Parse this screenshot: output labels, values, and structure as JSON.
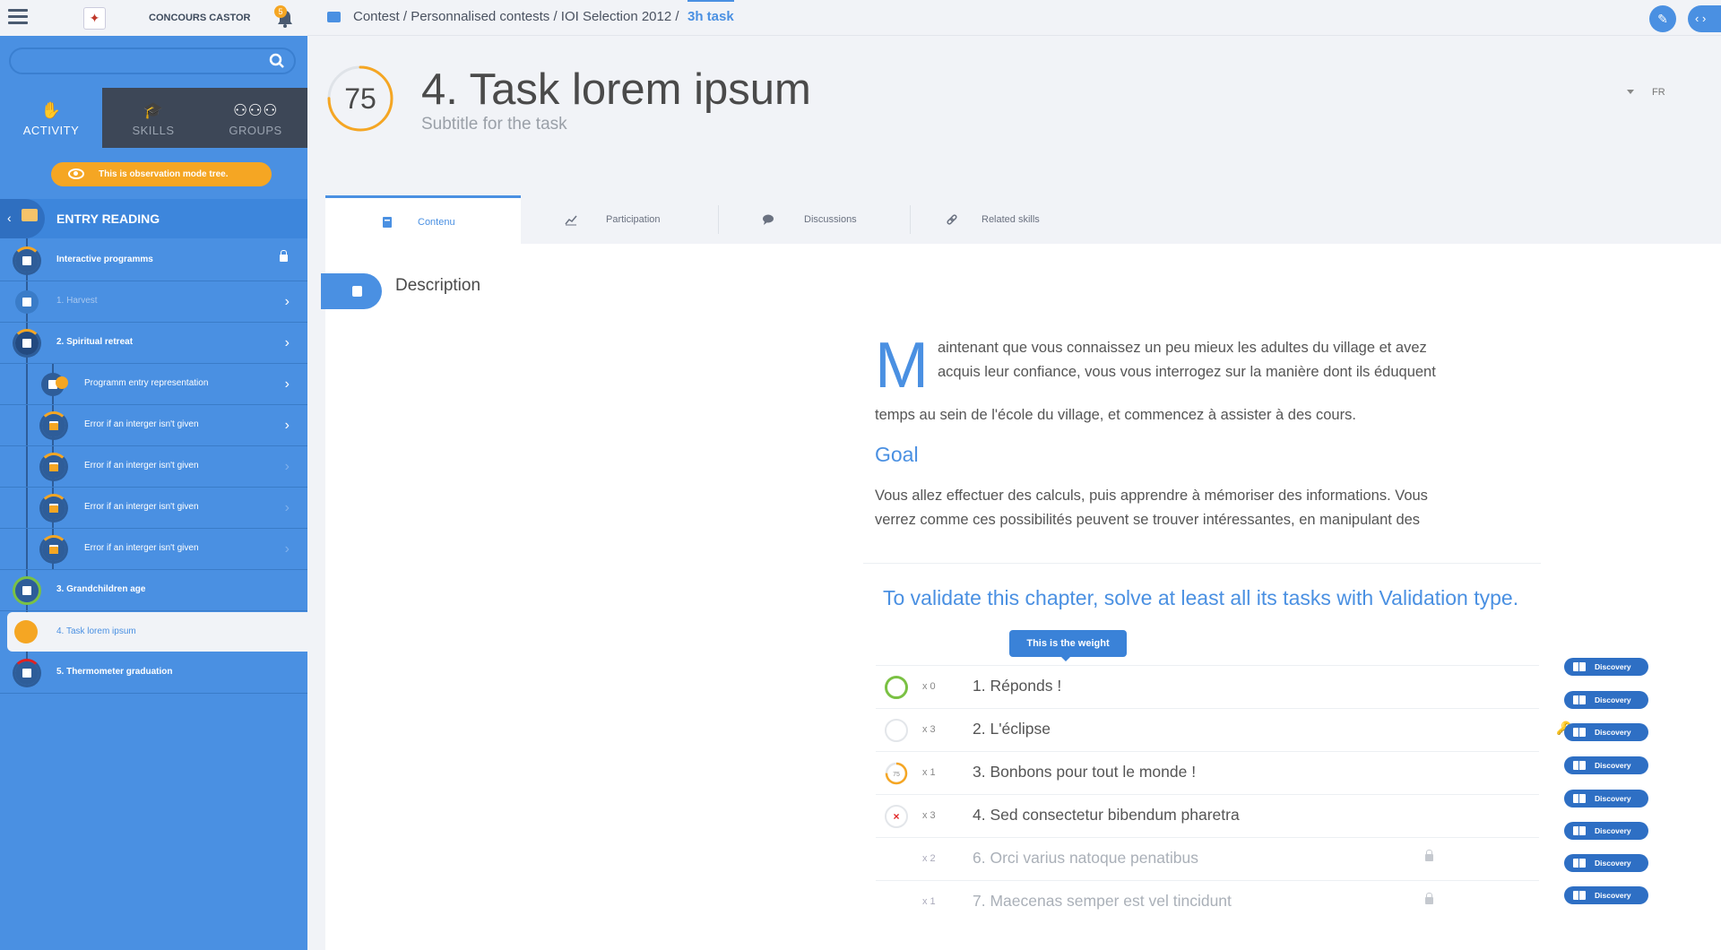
{
  "app": {
    "brand": "CONCOURS CASTOR",
    "notification_count": "5"
  },
  "sidebar": {
    "tabs": [
      {
        "label": "ACTIVITY",
        "icon": "hand-icon",
        "active": true
      },
      {
        "label": "SKILLS",
        "icon": "graduation-cap-icon",
        "active": false
      },
      {
        "label": "GROUPS",
        "icon": "groups-icon",
        "active": false
      }
    ],
    "observation_banner": "This is observation mode tree.",
    "section_title": "ENTRY READING",
    "items": [
      {
        "label": "Interactive programms",
        "locked": true
      },
      {
        "label": "1. Harvest"
      },
      {
        "label": "2. Spiritual retreat"
      },
      {
        "label": "Programm entry representation"
      },
      {
        "label": "Error if an interger isn't given"
      },
      {
        "label": "Error if an interger isn't given"
      },
      {
        "label": "Error if an interger isn't given"
      },
      {
        "label": "Error if an interger isn't given"
      },
      {
        "label": "3. Grandchildren age"
      },
      {
        "label": "4. Task lorem ipsum",
        "active": true
      },
      {
        "label": "5. Thermometer graduation"
      }
    ]
  },
  "breadcrumb": {
    "path": "Contest / Personnalised contests / IOI Selection 2012 /",
    "current": "3h task"
  },
  "task": {
    "score": "75",
    "score_fraction": 0.75,
    "title": "4. Task lorem ipsum",
    "subtitle": "Subtitle for the task",
    "language": "FR"
  },
  "tabs": [
    {
      "label": "Contenu",
      "icon": "book-icon",
      "active": true
    },
    {
      "label": "Participation",
      "icon": "chart-icon"
    },
    {
      "label": "Discussions",
      "icon": "chat-icon"
    },
    {
      "label": "Related skills",
      "icon": "link-icon"
    }
  ],
  "content": {
    "description_title": "Description",
    "dropcap": "M",
    "para1_start": "aintenant que vous connaissez un peu mieux les adultes du village et avez acquis leur confiance, vous vous interrogez sur la manière dont ils éduquent",
    "para1_end": "temps au sein de l'école du village, et commencez à assister à des cours.",
    "goal_title": "Goal",
    "para2": "Vous allez effectuer des calculs, puis apprendre à mémoriser des informations. Vous verrez comme ces possibilités peuvent se trouver intéressantes, en manipulant des",
    "validation_heading": "To validate this chapter, solve at least all its tasks with Validation type.",
    "weight_tooltip": "This is the weight",
    "tasks": [
      {
        "weight": "x 0",
        "name": "1. Réponds !",
        "status": "validated"
      },
      {
        "weight": "x 3",
        "name": "2. L'éclipse",
        "status": "not-started"
      },
      {
        "weight": "x 1",
        "name": "3. Bonbons pour tout le monde !",
        "status": "in-progress",
        "score": "75",
        "score_fraction": 0.75
      },
      {
        "weight": "x 3",
        "name": "4. Sed consectetur bibendum pharetra",
        "status": "failed"
      },
      {
        "weight": "x 2",
        "name": "6. Orci varius natoque penatibus",
        "status": "locked"
      },
      {
        "weight": "x 1",
        "name": "7. Maecenas semper est vel tincidunt",
        "status": "locked"
      }
    ],
    "discovery_label": "Discovery",
    "discovery_buttons": [
      "Discovery",
      "Discovery",
      "Discovery",
      "Discovery",
      "Discovery",
      "Discovery",
      "Discovery",
      "Discovery"
    ]
  },
  "colors": {
    "accent": "#4a90e2",
    "orange": "#f5a623",
    "green": "#7ac143",
    "red": "#e02020",
    "sidebar_dark": "#3d4757"
  }
}
